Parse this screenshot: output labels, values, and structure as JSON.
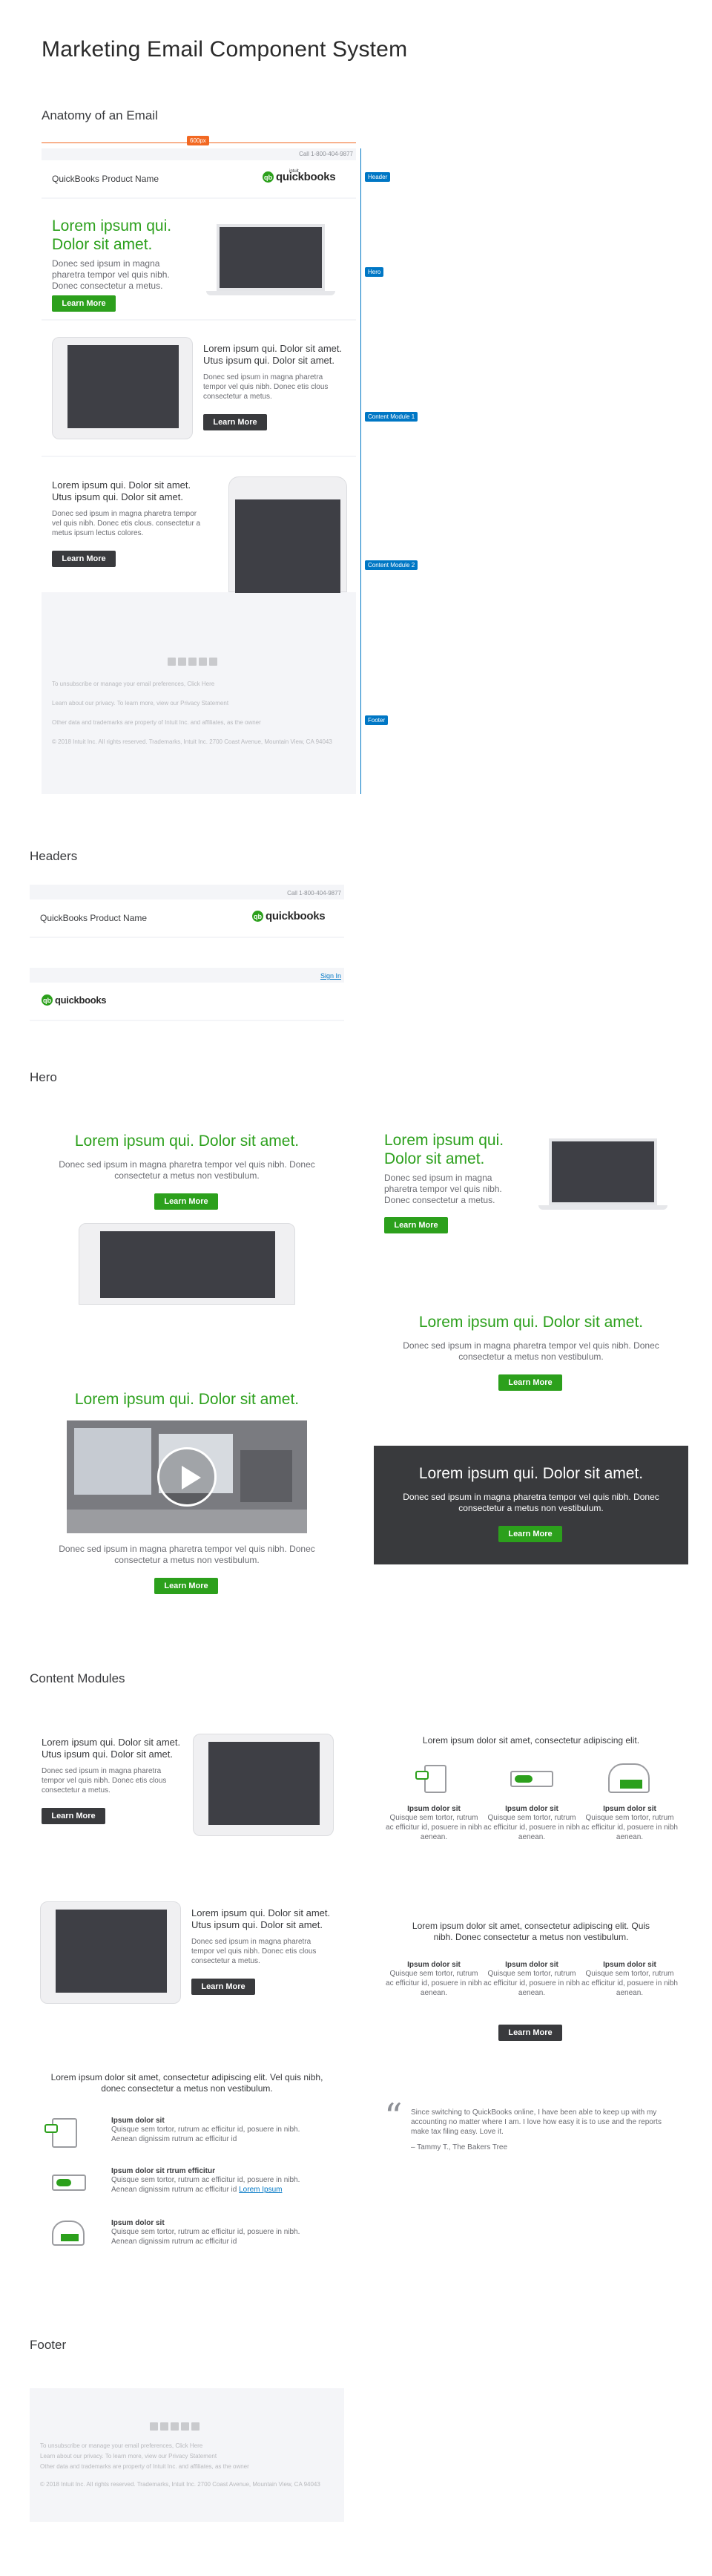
{
  "page_title": "Marketing Email Component System",
  "anatomy": {
    "title": "Anatomy of an Email",
    "width_badge": "600px",
    "call_text": "Call 1-800-404-9877",
    "product_name": "QuickBooks Product Name",
    "logo": {
      "intuit": "intuit",
      "word": "quickbooks"
    },
    "hero": {
      "headline": "Lorem ipsum qui. Dolor sit amet.",
      "body": "Donec sed ipsum in magna pharetra tempor vel quis nibh. Donec consectetur a metus.",
      "button": "Learn More"
    },
    "module1": {
      "headline": "Lorem ipsum qui. Dolor sit amet. Utus ipsum qui. Dolor sit amet.",
      "body": "Donec sed ipsum in magna pharetra tempor vel quis nibh. Donec etis clous consectetur a metus.",
      "button": "Learn More"
    },
    "module2": {
      "headline": "Lorem ipsum qui. Dolor sit amet. Utus ipsum qui. Dolor sit amet.",
      "body": "Donec sed ipsum in magna pharetra tempor vel quis nibh. Donec etis clous. consectetur a metus ipsum lectus colores.",
      "button": "Learn More"
    },
    "tags": {
      "header": "Header",
      "hero": "Hero",
      "cm1": "Content Module 1",
      "cm2": "Content Module 2",
      "footer": "Footer"
    }
  },
  "headers_section": {
    "title": "Headers",
    "header1": {
      "call_text": "Call 1-800-404-9877",
      "product_name": "QuickBooks Product Name"
    },
    "header2": {
      "sign_in": "Sign In"
    }
  },
  "hero_section": {
    "title": "Hero",
    "hero_a": {
      "headline": "Lorem ipsum qui. Dolor sit amet.",
      "body": "Donec sed ipsum in magna pharetra tempor vel quis nibh. Donec consectetur a metus non vestibulum.",
      "button": "Learn More"
    },
    "hero_b": {
      "headline": "Lorem ipsum qui. Dolor sit amet.",
      "body": "Donec sed ipsum in magna pharetra tempor vel quis nibh. Donec consectetur a metus.",
      "button": "Learn More"
    },
    "hero_c": {
      "headline": "Lorem ipsum qui. Dolor sit amet.",
      "body": "Donec sed ipsum in magna pharetra tempor vel quis nibh. Donec consectetur a metus non vestibulum.",
      "button": "Learn More"
    },
    "hero_d": {
      "headline": "Lorem ipsum qui. Dolor sit amet.",
      "body": "Donec sed ipsum in magna pharetra tempor vel quis nibh. Donec consectetur a metus non vestibulum.",
      "button": "Learn More"
    },
    "hero_e": {
      "headline": "Lorem ipsum qui. Dolor sit amet.",
      "body": "Donec sed ipsum in magna pharetra tempor vel quis nibh. Donec consectetur a metus non vestibulum.",
      "button": "Learn More"
    }
  },
  "content_section": {
    "title": "Content Modules",
    "cm_a": {
      "headline": "Lorem ipsum qui. Dolor sit amet. Utus ipsum qui. Dolor sit amet.",
      "body": "Donec sed ipsum in magna pharetra tempor vel quis nibh. Donec etis clous consectetur a metus.",
      "button": "Learn More"
    },
    "cm_b": {
      "headline": "Lorem ipsum qui. Dolor sit amet. Utus ipsum qui. Dolor sit amet.",
      "body": "Donec sed ipsum in magna pharetra tempor vel quis nibh. Donec etis clous consectetur a metus.",
      "button": "Learn More"
    },
    "cm_c": {
      "intro": "Lorem ipsum dolor sit amet, consectetur adipiscing elit. Vel quis nibh, donec consectetur a metus non vestibulum.",
      "items": [
        {
          "title": "Ipsum dolor sit",
          "body": "Quisque sem tortor, rutrum ac efficitur id, posuere in nibh. Aenean dignissim rutrum ac efficitur id"
        },
        {
          "title": "Ipsum dolor sit rtrum efficitur",
          "body": "Quisque sem tortor, rutrum ac efficitur id, posuere in nibh. Aenean dignissim rutrum ac efficitur id",
          "link": "Lorem Ipsum"
        },
        {
          "title": "Ipsum dolor sit",
          "body": "Quisque sem tortor, rutrum ac efficitur id, posuere in nibh. Aenean dignissim rutrum ac efficitur id"
        }
      ]
    },
    "cm_d": {
      "intro": "Lorem ipsum dolor sit amet, consectetur adipiscing elit.",
      "cols": [
        {
          "title": "Ipsum dolor sit",
          "body": "Quisque sem tortor, rutrum ac efficitur id, posuere in nibh aenean."
        },
        {
          "title": "Ipsum dolor sit",
          "body": "Quisque sem tortor, rutrum ac efficitur id, posuere in nibh aenean."
        },
        {
          "title": "Ipsum dolor sit",
          "body": "Quisque sem tortor, rutrum ac efficitur id, posuere in nibh aenean."
        }
      ]
    },
    "cm_e": {
      "intro": "Lorem ipsum dolor sit amet, consectetur adipiscing elit. Quis nibh. Donec consectetur a metus non vestibulum.",
      "cols": [
        {
          "title": "Ipsum dolor sit",
          "body": "Quisque sem tortor, rutrum ac efficitur id, posuere in nibh aenean."
        },
        {
          "title": "Ipsum dolor sit",
          "body": "Quisque sem tortor, rutrum ac efficitur id, posuere in nibh aenean."
        },
        {
          "title": "Ipsum dolor sit",
          "body": "Quisque sem tortor, rutrum ac efficitur id, posuere in nibh aenean."
        }
      ],
      "button": "Learn More"
    },
    "quote": {
      "mark": "“",
      "text": "Since switching to QuickBooks online, I have been able to keep up with my accounting no matter where I am. I love how easy it is to use and the reports make tax filing easy. Love it.",
      "author": "– Tammy T., The Bakers Tree"
    }
  },
  "footer_section": {
    "title": "Footer"
  },
  "footer": {
    "line1": "To unsubscribe or manage your email preferences, Click Here",
    "line2": "Learn about our privacy. To learn more, view our Privacy Statement",
    "line3": "Other data and trademarks are property of Intuit Inc. and affiliates, as the owner",
    "line4": "© 2018 Intuit Inc. All rights reserved. Trademarks, Intuit Inc. 2700 Coast Avenue, Mountain View, CA 94043"
  },
  "colors": {
    "green": "#2ca01c",
    "dark": "#393a3d",
    "blue": "#0077c5",
    "badge": "#f26822"
  }
}
